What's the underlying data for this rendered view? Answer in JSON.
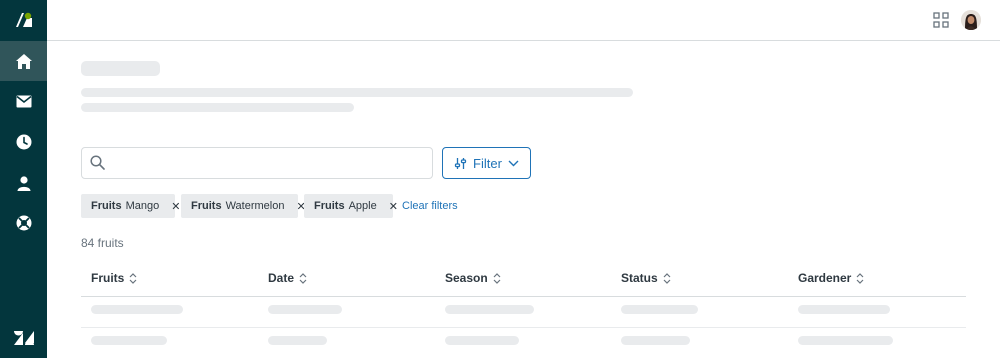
{
  "sidebar": {
    "items": [
      {
        "name": "home",
        "active": true
      },
      {
        "name": "mail",
        "active": false
      },
      {
        "name": "clock",
        "active": false
      },
      {
        "name": "user",
        "active": false
      },
      {
        "name": "support",
        "active": false
      }
    ]
  },
  "search": {
    "value": "",
    "placeholder": ""
  },
  "filter": {
    "label": "Filter"
  },
  "tags": [
    {
      "key": "Fruits",
      "value": "Mango"
    },
    {
      "key": "Fruits",
      "value": "Watermelon"
    },
    {
      "key": "Fruits",
      "value": "Apple"
    }
  ],
  "clear_filters": "Clear filters",
  "result_count": "84 fruits",
  "table": {
    "columns": [
      "Fruits",
      "Date",
      "Season",
      "Status",
      "Gardener"
    ]
  },
  "colors": {
    "sidebar": "#03363d",
    "sidebar_active": "#30555a",
    "accent": "#1f73b7",
    "brand_green": "#78a300"
  }
}
